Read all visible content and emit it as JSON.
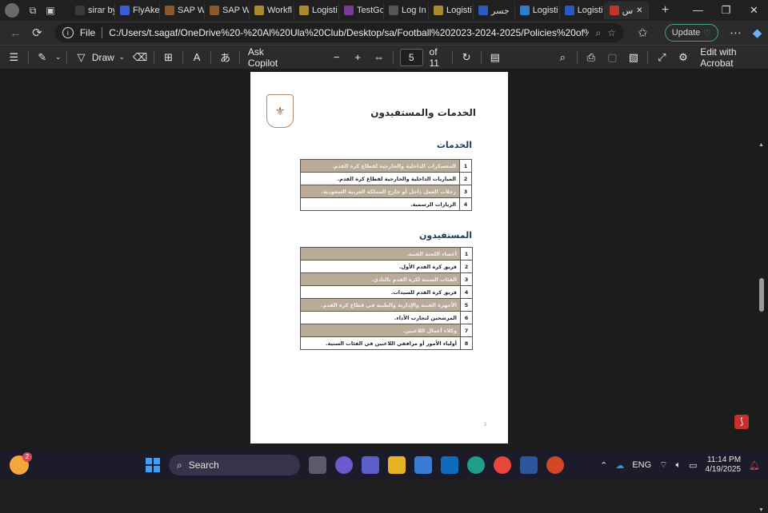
{
  "browser": {
    "tabs": [
      {
        "label": "sirar by",
        "color": "#3a3a3a"
      },
      {
        "label": "FlyAke",
        "color": "#3b5bd6"
      },
      {
        "label": "SAP W",
        "color": "#8a5a2b"
      },
      {
        "label": "SAP W",
        "color": "#8a5a2b"
      },
      {
        "label": "Workfl",
        "color": "#a88a2a"
      },
      {
        "label": "Logisti",
        "color": "#a88a2a"
      },
      {
        "label": "TestGo",
        "color": "#7a3a9a"
      },
      {
        "label": "Log In",
        "color": "#555555"
      },
      {
        "label": "Logisti",
        "color": "#a88a2a"
      },
      {
        "label": "جسر",
        "color": "#2a5bc4"
      },
      {
        "label": "Logisti",
        "color": "#2f7bd8"
      },
      {
        "label": "Logisti",
        "color": "#2a5bc4"
      },
      {
        "label": "س",
        "color": "#c4302b",
        "active": true
      }
    ],
    "new_tab": "+",
    "file_label": "File",
    "url": "C:/Users/t.sagaf/OneDrive%20-%20Al%20Ula%20Club/Desktop/sa/Football%202023-2024-2025/Policies%20of%20the%20L...",
    "update_label": "Update"
  },
  "pdf_toolbar": {
    "draw_label": "Draw",
    "ask_copilot": "Ask Copilot",
    "page_current": "5",
    "page_total": "of 11",
    "edit_acrobat": "Edit with Acrobat"
  },
  "document": {
    "title": "الخدمات والمستفيدون",
    "services_heading": "الخدمات",
    "services": [
      {
        "num": "1",
        "text": "المعسكرات الداخلية والخارجية لقطاع كرة القدم.",
        "shaded": true
      },
      {
        "num": "2",
        "text": "المباريات الداخلية والخارجية لقطاع كرة القدم.",
        "shaded": false
      },
      {
        "num": "3",
        "text": "رحلات العمل داخل أو خارج المملكة العربية السعودية.",
        "shaded": true
      },
      {
        "num": "4",
        "text": "الزيارات الرسمية.",
        "shaded": false
      }
    ],
    "beneficiaries_heading": "المستفيدون",
    "beneficiaries": [
      {
        "num": "1",
        "text": "أعضاء اللجنة الفنية.",
        "shaded": true
      },
      {
        "num": "2",
        "text": "فريق كرة القدم الأول.",
        "shaded": false
      },
      {
        "num": "3",
        "text": "الفئات السنية لكرة القدم بالنادي.",
        "shaded": true
      },
      {
        "num": "4",
        "text": "فريق كرة القدم للسيدات.",
        "shaded": false
      },
      {
        "num": "5",
        "text": "الأجهزة الفنية والإدارية والطبية في قطاع كرة القدم.",
        "shaded": true
      },
      {
        "num": "6",
        "text": "المرشحين لتجارب الأداء.",
        "shaded": false
      },
      {
        "num": "7",
        "text": "وكلاء أعمال اللاعبين.",
        "shaded": true
      },
      {
        "num": "8",
        "text": "أولياء الأمور أو مرافقي اللاعبين في الفئات السنية.",
        "shaded": false
      }
    ],
    "page_number": "3"
  },
  "taskbar": {
    "weather_badge": "2",
    "search_label": "Search",
    "language": "ENG",
    "time": "11:14 PM",
    "date": "4/19/2025"
  }
}
